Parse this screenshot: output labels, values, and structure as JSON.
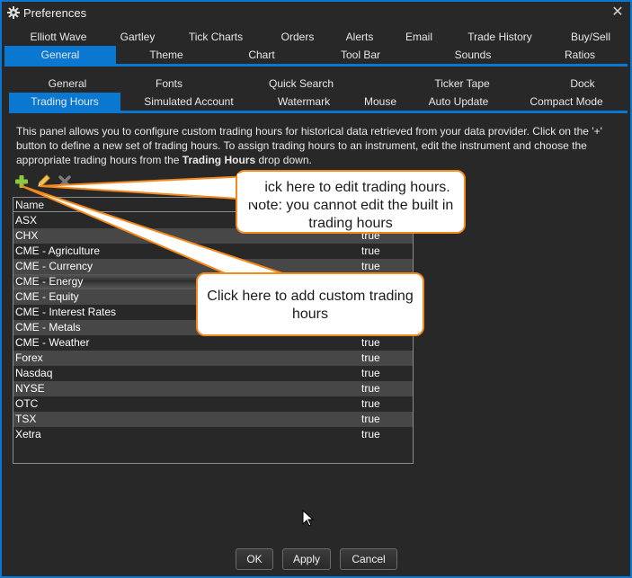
{
  "window": {
    "title": "Preferences",
    "icon": "gear-icon",
    "close_icon": "close-icon",
    "close_glyph": "✕"
  },
  "top_tabs": {
    "row1": [
      "Elliott Wave",
      "Gartley",
      "Tick Charts",
      "Orders",
      "Alerts",
      "Email",
      "Trade History",
      "Buy/Sell"
    ],
    "row2": [
      "General",
      "Theme",
      "Chart",
      "Tool Bar",
      "Sounds",
      "Ratios"
    ],
    "active": "General"
  },
  "sub_tabs": {
    "row1": [
      "General",
      "Fonts",
      "Quick Search",
      "Ticker Tape",
      "Dock"
    ],
    "row2": [
      "Trading Hours",
      "Simulated Account",
      "Watermark",
      "Mouse",
      "Auto Update",
      "Compact Mode"
    ],
    "active": "Trading Hours"
  },
  "description": {
    "part1": "This panel allows you to configure custom trading hours for historical data retrieved from your data provider. Click on the '+' button to define a new set of trading hours. To assign trading hours to an instrument, edit the instrument and choose the appropriate trading hours from the ",
    "bold": "Trading Hours",
    "part2": " drop down."
  },
  "toolbar": {
    "add_icon": "plus-icon",
    "edit_icon": "pencil-icon",
    "delete_icon": "delete-x-icon"
  },
  "grid": {
    "columns": [
      "Name",
      ""
    ],
    "selected_row": "CME - Energy",
    "rows": [
      {
        "name": "ASX",
        "value": ""
      },
      {
        "name": "CHX",
        "value": "true"
      },
      {
        "name": "CME - Agriculture",
        "value": "true"
      },
      {
        "name": "CME - Currency",
        "value": "true"
      },
      {
        "name": "CME - Energy",
        "value": ""
      },
      {
        "name": "CME - Equity",
        "value": ""
      },
      {
        "name": "CME - Interest Rates",
        "value": ""
      },
      {
        "name": "CME - Metals",
        "value": ""
      },
      {
        "name": "CME - Weather",
        "value": "true"
      },
      {
        "name": "Forex",
        "value": "true"
      },
      {
        "name": "Nasdaq",
        "value": "true"
      },
      {
        "name": "NYSE",
        "value": "true"
      },
      {
        "name": "OTC",
        "value": "true"
      },
      {
        "name": "TSX",
        "value": "true"
      },
      {
        "name": "Xetra",
        "value": "true"
      }
    ]
  },
  "callouts": {
    "edit": "Click here to edit trading hours. Note: you cannot edit the built in trading hours",
    "add": "Click here to add custom trading hours",
    "border_color": "#f58a1c"
  },
  "buttons": {
    "ok": "OK",
    "apply": "Apply",
    "cancel": "Cancel"
  },
  "colors": {
    "accent": "#0a78d0",
    "background": "#282828",
    "row_alt": "#474747",
    "add_green": "#8dc63f"
  }
}
